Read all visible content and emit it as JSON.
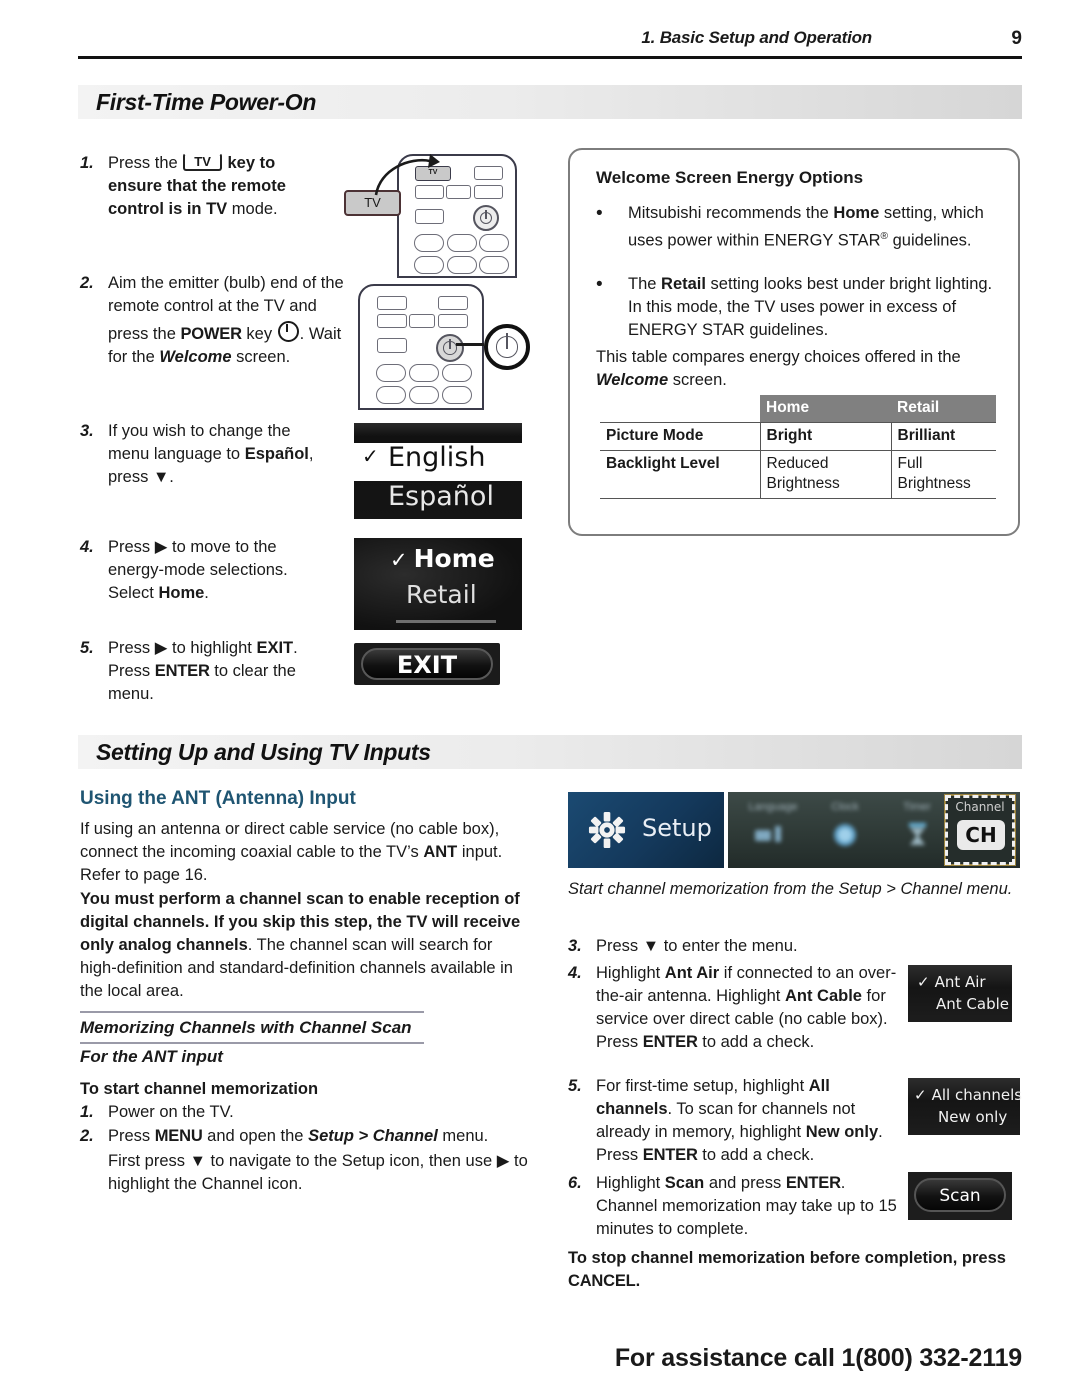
{
  "header": {
    "chapter_title": "1.  Basic Setup and Operation",
    "page_number": "9"
  },
  "sections": {
    "power_on": {
      "banner": "First-Time Power-On",
      "steps": [
        {
          "num": "1.",
          "parts": [
            "Press the ",
            "TV",
            " key to ensure that the remote control is in ",
            "TV",
            " mode."
          ]
        },
        {
          "num": "2.",
          "parts": [
            "Aim the emitter (bulb) end of the remote control at the TV and press the ",
            "POWER",
            " key ",
            ".  Wait for the ",
            "Welcome",
            " screen."
          ]
        },
        {
          "num": "3.",
          "parts": [
            "If you wish to change the menu language to ",
            "Español",
            ", press ",
            "▼",
            "."
          ]
        },
        {
          "num": "4.",
          "parts": [
            "Press ",
            "▶",
            " to move to the energy-mode selections.  Select ",
            "Home",
            "."
          ]
        },
        {
          "num": "5.",
          "parts": [
            "Press ",
            "▶",
            " to highlight ",
            "EXIT",
            ".  Press ",
            "ENTER",
            " to clear the menu."
          ]
        }
      ]
    },
    "tv_inputs": {
      "banner": "Setting Up and Using TV Inputs",
      "subhead": "Using the ANT (Antenna) Input",
      "paragraph_1_pre": "If using an antenna or direct cable service (no cable box), connect the incoming coaxial cable to the TV’s ",
      "paragraph_1_bold": "ANT",
      "paragraph_1_post": " input.  Refer to page 16.",
      "paragraph_2_bold": "You must perform a channel scan to enable reception of digital channels.  If you skip this step, the TV will receive only analog channels",
      "paragraph_2_post": ".  The channel scan will search for high-definition and standard-definition channels available in the local area.",
      "memorizing_head": "Memorizing Channels with Channel Scan",
      "for_ant_input": "For the ANT input",
      "to_start_head": "To start channel memorization",
      "left_steps": [
        {
          "num": "1.",
          "text": "Power on the TV."
        },
        {
          "num": "2.",
          "pre": "Press ",
          "menu_key": "MENU",
          "mid": " and open the ",
          "path": "Setup > Channel",
          "post": " menu.",
          "sub_pre": "First press ",
          "sub_arrow_down": "▼",
          "sub_mid": " to navigate to the Setup icon, then use ",
          "sub_arrow_right": "▶",
          "sub_post": " to highlight the Channel icon."
        }
      ],
      "caption": "Start channel memorization from the Setup > Channel menu.",
      "right_steps": [
        {
          "num": "3.",
          "pre": "Press ",
          "arrow": "▼",
          "post": " to enter the menu."
        },
        {
          "num": "4.",
          "segments": [
            {
              "t": "Highlight ",
              "style": "n"
            },
            {
              "t": "Ant Air",
              "style": "b"
            },
            {
              "t": " if connected to an over-the-air antenna.  Highlight ",
              "style": "n"
            },
            {
              "t": "Ant Cable",
              "style": "b"
            },
            {
              "t": " for service over direct cable (no cable box).  Press ",
              "style": "n"
            },
            {
              "t": "ENTER",
              "style": "c"
            },
            {
              "t": " to add a check.",
              "style": "n"
            }
          ]
        },
        {
          "num": "5.",
          "segments": [
            {
              "t": "For first-time setup, highlight ",
              "style": "n"
            },
            {
              "t": "All channels",
              "style": "b"
            },
            {
              "t": ".  To scan for channels not already in memory, highlight ",
              "style": "n"
            },
            {
              "t": "New only",
              "style": "b"
            },
            {
              "t": ".  Press ",
              "style": "n"
            },
            {
              "t": "ENTER",
              "style": "c"
            },
            {
              "t": " to add a check.",
              "style": "n"
            }
          ]
        },
        {
          "num": "6.",
          "segments": [
            {
              "t": "Highlight ",
              "style": "n"
            },
            {
              "t": "Scan",
              "style": "b"
            },
            {
              "t": " and press ",
              "style": "n"
            },
            {
              "t": "ENTER",
              "style": "c"
            },
            {
              "t": ".  Channel memorization may take up to 15 minutes to complete.",
              "style": "n"
            }
          ]
        }
      ],
      "stop_note_pre": "To stop channel memorization before completion, press ",
      "stop_note_key": "CANCEL",
      "stop_note_post": "."
    }
  },
  "energy_box": {
    "title": "Welcome Screen Energy Options",
    "bullets": [
      {
        "pre": "Mitsubishi recommends the ",
        "bold": "Home",
        "post": " setting, which uses power within ENERGY STAR",
        "reg": "®",
        "tail": " guidelines."
      },
      {
        "pre": "The ",
        "bold": "Retail",
        "post": " setting looks best under bright lighting.  In this mode, the TV uses power in excess of ENERGY STAR guidelines.",
        "reg": "",
        "tail": ""
      }
    ],
    "note_pre": "This table compares energy choices offered in the ",
    "note_italic": "Welcome",
    "note_post": " screen.",
    "table": {
      "headers": [
        "",
        "Home",
        "Retail"
      ],
      "rows": [
        {
          "label": "Picture Mode",
          "home": "Bright",
          "retail": "Brilliant",
          "bold": true
        },
        {
          "label": "Backlight Level",
          "home": "Reduced Brightness",
          "retail": "Full  Brightness",
          "bold": false
        }
      ]
    }
  },
  "remote_callouts": {
    "tv_key_label": "TV",
    "tv_button_label": "TV"
  },
  "osd": {
    "language": {
      "selected": "English",
      "other": "Español",
      "check": "✓"
    },
    "energy": {
      "selected": "Home",
      "other": "Retail",
      "check": "✓"
    },
    "exit": {
      "label": "EXIT"
    },
    "setup": {
      "panel_label": "Setup",
      "icons": [
        "Language",
        "Clock",
        "Timer"
      ],
      "highlighted_label": "Channel",
      "highlighted_badge": "CH"
    },
    "ant": {
      "selected": "Ant Air",
      "other": "Ant Cable",
      "check": "✓"
    },
    "channels": {
      "selected": "All channels",
      "other": "New only",
      "check": "✓"
    },
    "scan": {
      "label": "Scan"
    }
  },
  "footer": "For assistance call 1(800) 332-2119",
  "colors": {
    "accent_heading": "#1f5572",
    "banner_start": "#f3f3f3",
    "banner_end": "#d6d6d6",
    "table_header_bg": "#808080",
    "setup_panel_blue": "#14395c"
  }
}
